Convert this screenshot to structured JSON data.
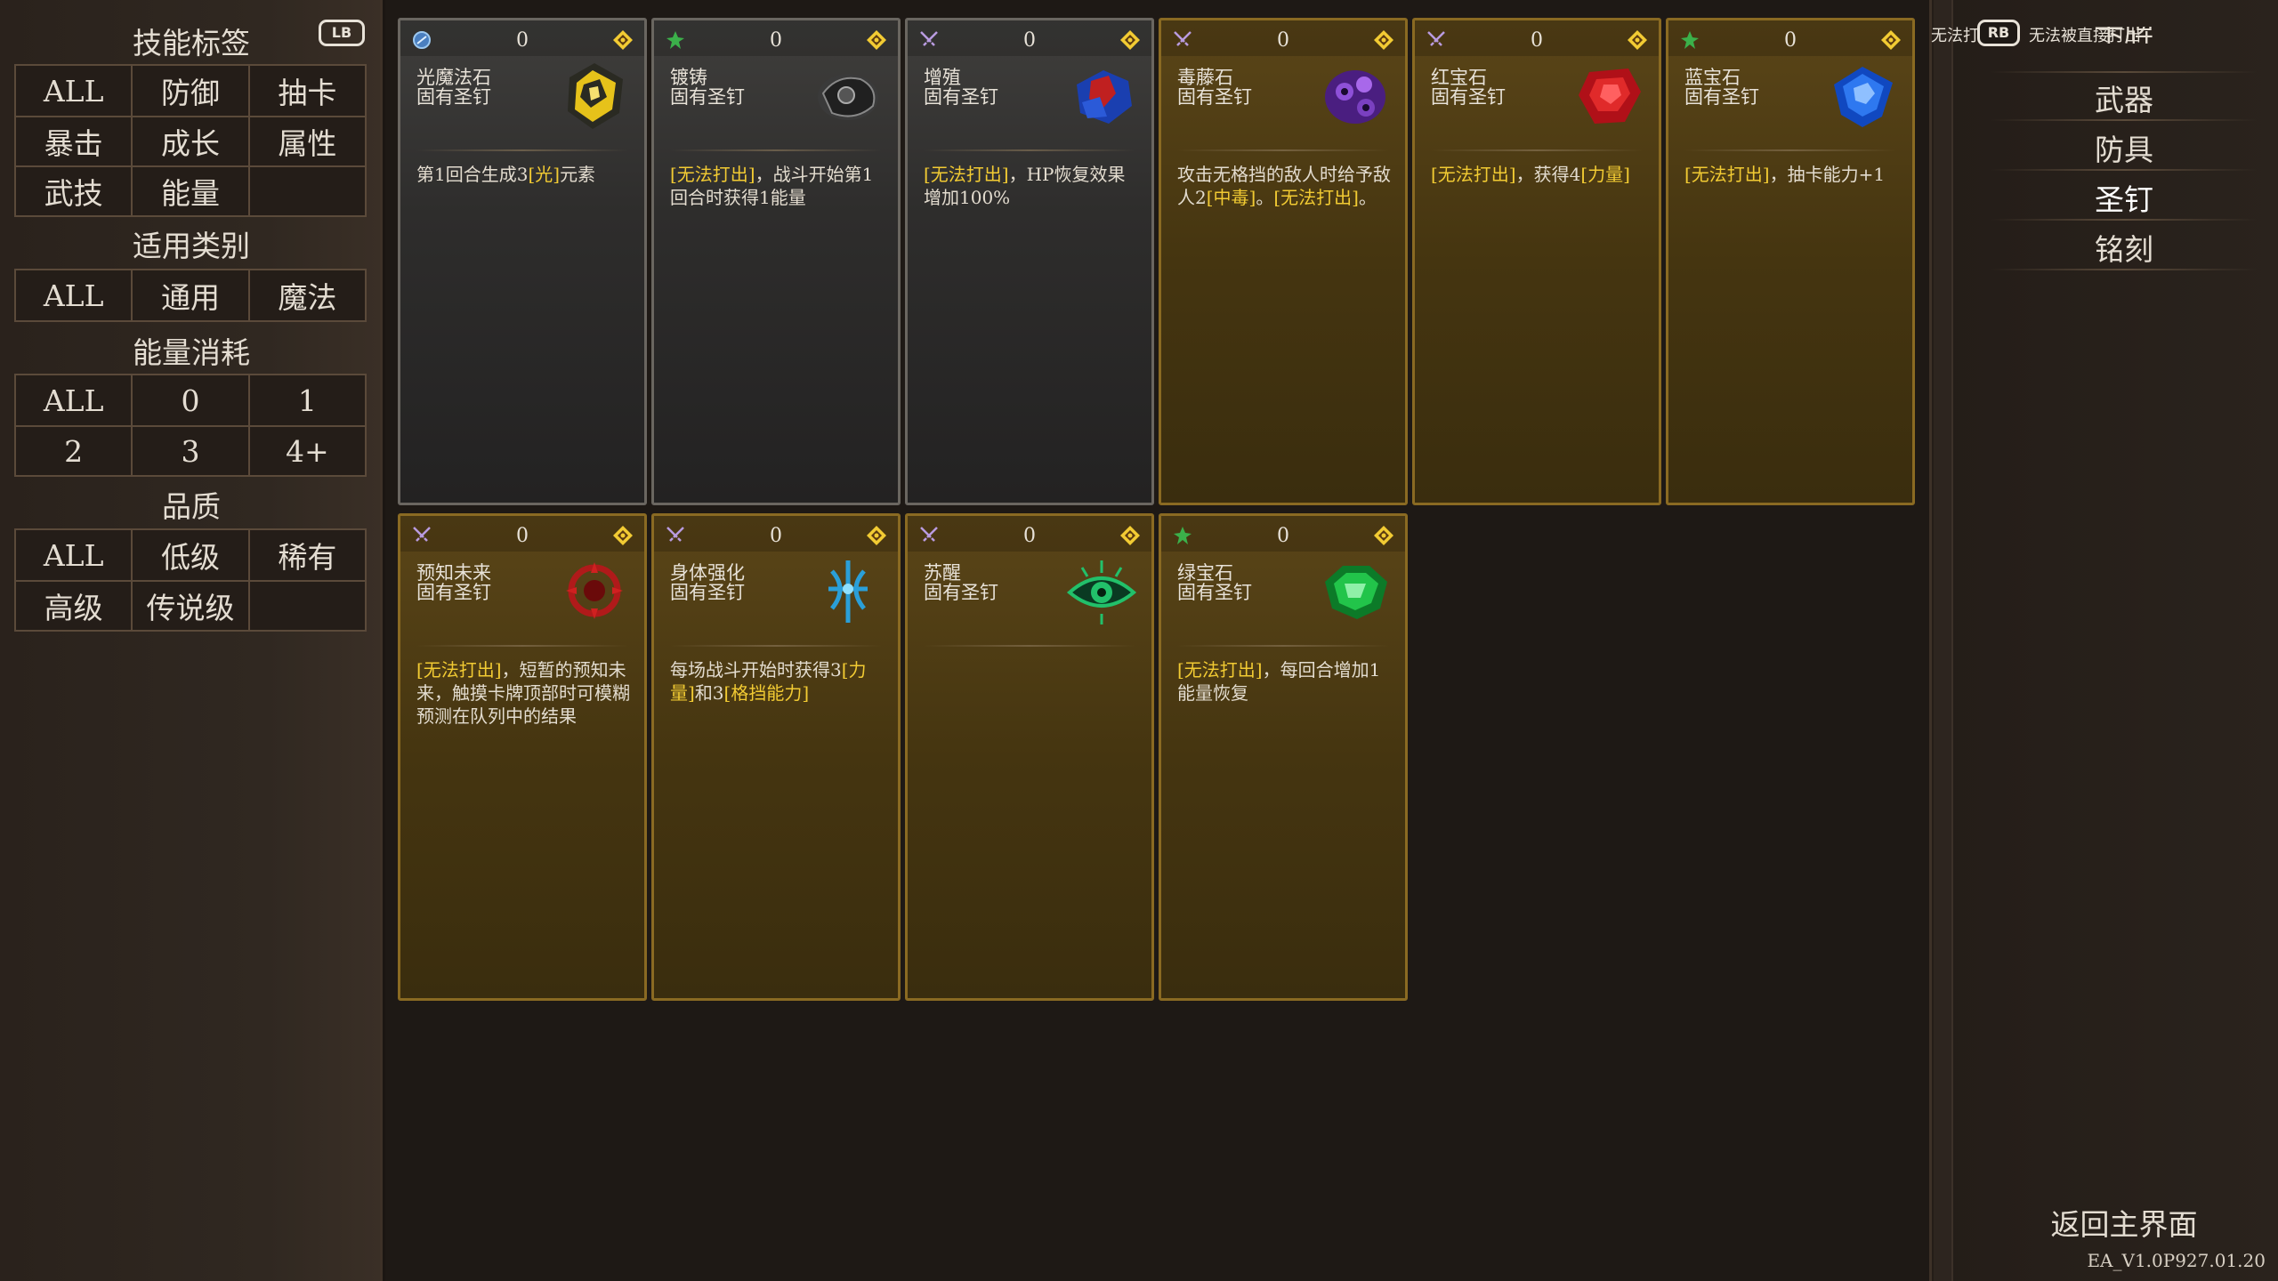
{
  "filters": {
    "skill_tags": {
      "title": "技能标签",
      "lb": "LB",
      "rows": [
        [
          "ALL",
          "防御",
          "抽卡"
        ],
        [
          "暴击",
          "成长",
          "属性"
        ],
        [
          "武技",
          "能量",
          ""
        ]
      ]
    },
    "applicable": {
      "title": "适用类别",
      "rows": [
        [
          "ALL",
          "通用",
          "魔法"
        ]
      ]
    },
    "energy": {
      "title": "能量消耗",
      "rows": [
        [
          "ALL",
          "0",
          "1"
        ],
        [
          "2",
          "3",
          "4+"
        ]
      ]
    },
    "quality": {
      "title": "品质",
      "rows": [
        [
          "ALL",
          "低级",
          "稀有"
        ],
        [
          "高级",
          "传说级",
          ""
        ]
      ]
    }
  },
  "cards": [
    {
      "name": "光魔法石",
      "sub": "固有圣钉",
      "cost": "0",
      "style": "gray",
      "type_icon": "magic-icon",
      "art": "yellow-stone-icon",
      "desc": [
        "第1回合生成3",
        "[光]",
        "元素"
      ]
    },
    {
      "name": "镀铸",
      "sub": "固有圣钉",
      "cost": "0",
      "style": "gray",
      "type_icon": "leaf-icon",
      "art": "dark-ore-icon",
      "desc": [
        "[无法打出]",
        "，战斗开始第1回合时获得1能量"
      ]
    },
    {
      "name": "增殖",
      "sub": "固有圣钉",
      "cost": "0",
      "style": "gray",
      "type_icon": "swords-icon",
      "art": "blue-red-crystal-icon",
      "desc": [
        "[无法打出]",
        "，HP恢复效果增加100%"
      ]
    },
    {
      "name": "毒藤石",
      "sub": "固有圣钉",
      "cost": "0",
      "style": "gold",
      "type_icon": "swords-icon",
      "art": "purple-stone-icon",
      "desc": [
        "攻击无格挡的敌人时给予敌人2",
        "[中毒]",
        "。",
        "[无法打出]",
        "。"
      ]
    },
    {
      "name": "红宝石",
      "sub": "固有圣钉",
      "cost": "0",
      "style": "gold",
      "type_icon": "swords-icon",
      "art": "ruby-icon",
      "desc": [
        "[无法打出]",
        "，获得4",
        "[力量]"
      ]
    },
    {
      "name": "蓝宝石",
      "sub": "固有圣钉",
      "cost": "0",
      "style": "gold",
      "type_icon": "leaf-icon",
      "art": "sapphire-icon",
      "desc": [
        "[无法打出]",
        "，抽卡能力+1"
      ]
    },
    {
      "name": "预知未来",
      "sub": "固有圣钉",
      "cost": "0",
      "style": "gold",
      "type_icon": "swords-icon",
      "art": "red-sigil-icon",
      "desc": [
        "[无法打出]",
        "，短暂的预知未来，触摸卡牌顶部时可模糊预测在队列中的结果"
      ]
    },
    {
      "name": "身体强化",
      "sub": "固有圣钉",
      "cost": "0",
      "style": "gold",
      "type_icon": "swords-icon",
      "art": "blue-rune-icon",
      "desc": [
        "每场战斗开始时获得3",
        "[力量]",
        "和3",
        "[格挡能力]"
      ]
    },
    {
      "name": "苏醒",
      "sub": "固有圣钉",
      "cost": "0",
      "style": "gold",
      "type_icon": "swords-icon",
      "art": "green-eye-icon",
      "desc": []
    },
    {
      "name": "绿宝石",
      "sub": "固有圣钉",
      "cost": "0",
      "style": "gold",
      "type_icon": "leaf-icon",
      "art": "emerald-icon",
      "desc": [
        "[无法打出]",
        "，每回合增加1能量恢复"
      ]
    }
  ],
  "hint": {
    "text_left": "无法打",
    "rb": "RB",
    "text_right": "无法被直接打出"
  },
  "menu": {
    "items": [
      "卡牌",
      "武器",
      "防具",
      "圣钉",
      "铭刻"
    ],
    "selected": "圣钉",
    "back": "返回主界面"
  },
  "version": "EA_V1.0P927.01.20",
  "colors": {
    "highlight": "#f2cb33",
    "gold_card": "#453510",
    "gray_card": "#2e2d2c"
  }
}
